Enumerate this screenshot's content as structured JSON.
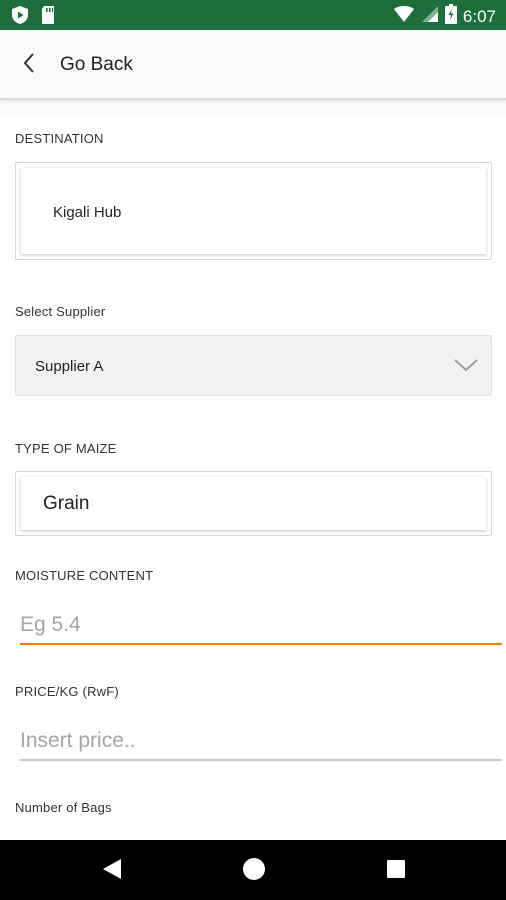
{
  "status_bar": {
    "time": "6:07",
    "icons": [
      "play-protect-icon",
      "sd-card-icon",
      "wifi-icon",
      "signal-icon",
      "battery-icon"
    ]
  },
  "header": {
    "back_icon": "chevron-left-icon",
    "title": "Go Back"
  },
  "form": {
    "destination": {
      "label": "DESTINATION",
      "value": "Kigali Hub"
    },
    "supplier": {
      "label": "Select Supplier",
      "value": "Supplier A",
      "icon": "chevron-down-icon"
    },
    "maize_type": {
      "label": "TYPE OF MAIZE",
      "value": "Grain"
    },
    "moisture": {
      "label": "MOISTURE CONTENT",
      "placeholder": "Eg 5.4"
    },
    "price": {
      "label": "PRICE/KG (RwF)",
      "placeholder": "Insert price.."
    },
    "bags": {
      "label": "Number of Bags"
    }
  },
  "nav_bar": {
    "icons": [
      "back-triangle-icon",
      "home-circle-icon",
      "recents-square-icon"
    ]
  },
  "colors": {
    "status_bar": "#1e6e3c",
    "focus_underline": "#f57c00",
    "underline": "#c8c8c8"
  }
}
